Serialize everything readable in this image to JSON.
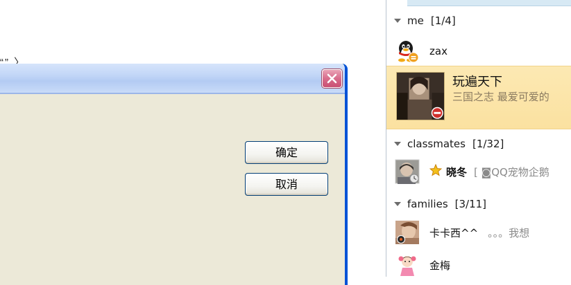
{
  "background": {
    "fragment_text": "“” 〉"
  },
  "dialog": {
    "close_glyph": "✕",
    "ok_label": "确定",
    "cancel_label": "取消"
  },
  "qq": {
    "groups": [
      {
        "name": "me",
        "count": "[1/4]"
      },
      {
        "name": "classmates",
        "count": "[1/32]"
      },
      {
        "name": "families",
        "count": "[3/11]"
      }
    ],
    "me_contacts": [
      {
        "name": "zax",
        "icon": "penguin-icon"
      },
      {
        "name": "玩遍天下",
        "signature": "三国之志 最爱可爱的",
        "icon": "photo-avatar",
        "selected": true
      }
    ],
    "classmates_contacts": [
      {
        "name": "晓冬",
        "signature": "[ ◙QQ宠物企鹅",
        "icon": "photo-avatar"
      }
    ],
    "families_contacts": [
      {
        "name": "卡卡西^^",
        "signature": "。。。我想",
        "icon": "photo-avatar"
      },
      {
        "name": "金梅",
        "icon": "girl-avatar"
      }
    ]
  },
  "colors": {
    "selection": "#fbe1a0",
    "xp_blue_border": "#0052d6",
    "close_red": "#d86d8c",
    "dialog_bg": "#ece9d8"
  }
}
